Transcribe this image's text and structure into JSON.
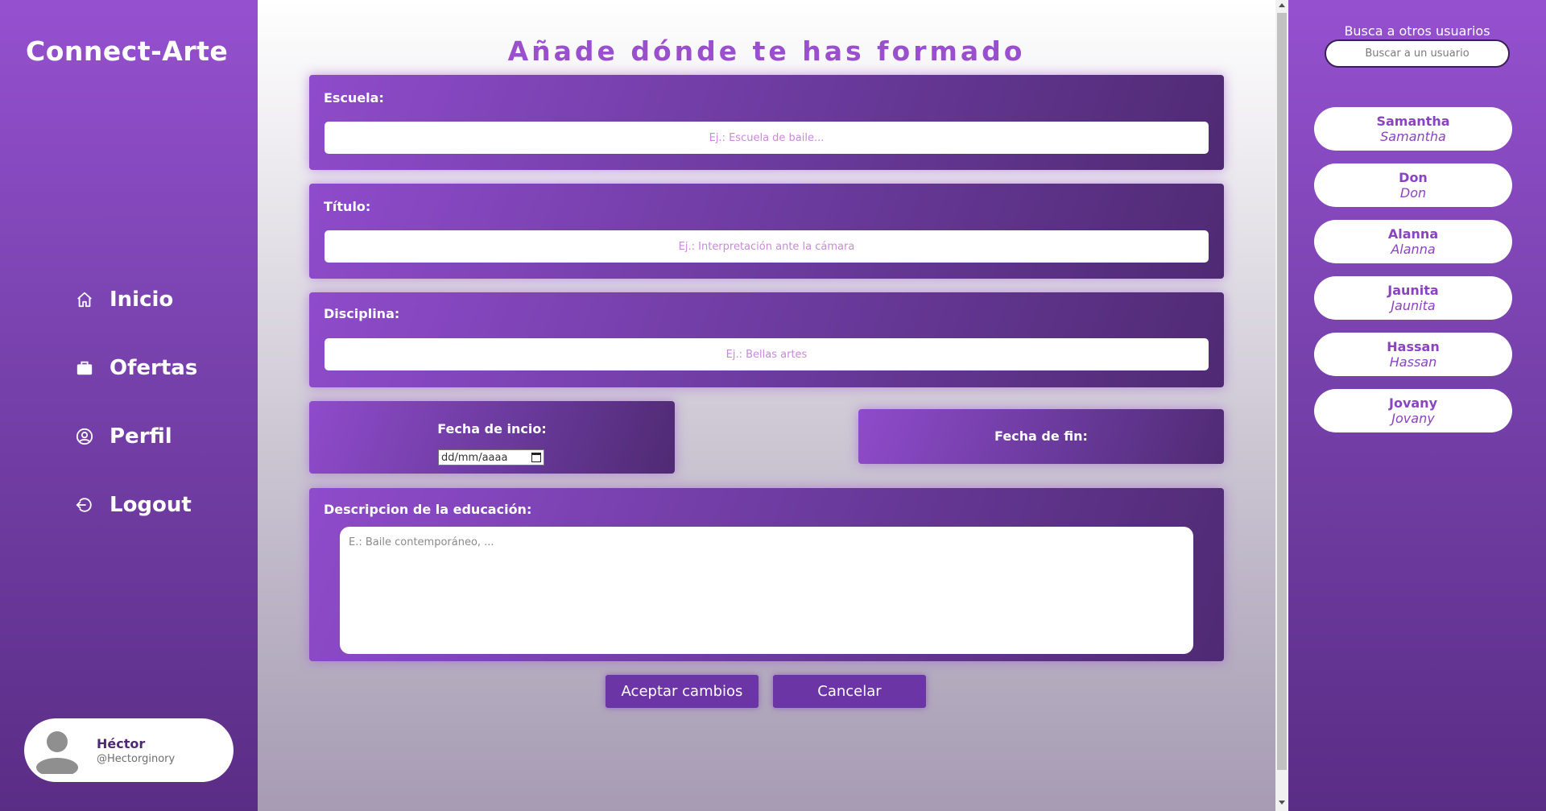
{
  "app": {
    "brand": "Connect-Arte"
  },
  "nav": {
    "items": [
      {
        "label": "Inicio",
        "icon": "home-icon"
      },
      {
        "label": "Ofertas",
        "icon": "briefcase-icon"
      },
      {
        "label": "Perfil",
        "icon": "user-circle-icon"
      },
      {
        "label": "Logout",
        "icon": "logout-icon"
      }
    ]
  },
  "profile": {
    "name": "Héctor",
    "handle": "@Hectorginory"
  },
  "page": {
    "title": "Añade dónde te has formado"
  },
  "form": {
    "school": {
      "label": "Escuela:",
      "placeholder": "Ej.: Escuela de baile..."
    },
    "title": {
      "label": "Título:",
      "placeholder": "Ej.: Interpretación ante la cámara"
    },
    "discipline": {
      "label": "Disciplina:",
      "placeholder": "Ej.: Bellas artes"
    },
    "start_date": {
      "label": "Fecha de incio:",
      "value": "dd/mm/aaaa"
    },
    "end_date": {
      "label": "Fecha de fin:"
    },
    "description": {
      "label": "Descripcion de la educación:",
      "placeholder": "E.: Baile contemporáneo, ..."
    },
    "accept_label": "Aceptar cambios",
    "cancel_label": "Cancelar"
  },
  "search": {
    "title": "Busca a otros usuarios",
    "placeholder": "Buscar a un usuario"
  },
  "users": [
    {
      "name": "Samantha",
      "handle": "Samantha"
    },
    {
      "name": "Don",
      "handle": "Don"
    },
    {
      "name": "Alanna",
      "handle": "Alanna"
    },
    {
      "name": "Jaunita",
      "handle": "Jaunita"
    },
    {
      "name": "Hassan",
      "handle": "Hassan"
    },
    {
      "name": "Jovany",
      "handle": "Jovany"
    }
  ],
  "colors": {
    "accent": "#9550cf",
    "dark_purple": "#4f2a73",
    "button": "#6c35a5",
    "title": "#9a4fcf"
  }
}
